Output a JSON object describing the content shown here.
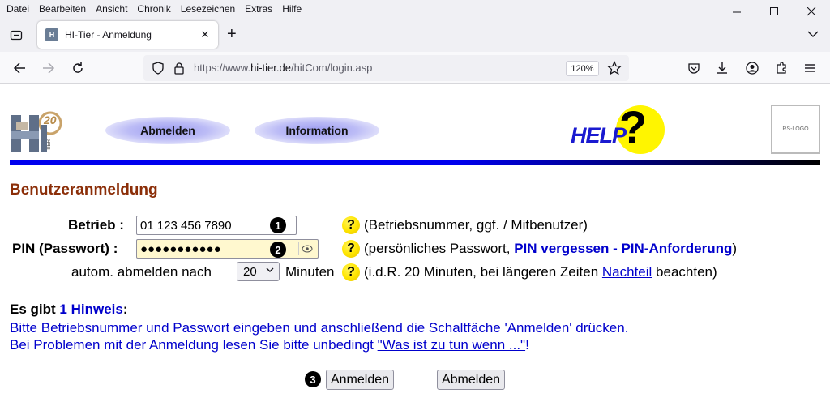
{
  "menubar": {
    "items": [
      "Datei",
      "Bearbeiten",
      "Ansicht",
      "Chronik",
      "Lesezeichen",
      "Extras",
      "Hilfe"
    ]
  },
  "tab": {
    "title": "HI-Tier - Anmeldung",
    "favicon_text": "H"
  },
  "navbar": {
    "url_prefix": "https://www.",
    "url_domain": "hi-tier.de",
    "url_path": "/hitCom/login.asp",
    "zoom": "120%"
  },
  "header": {
    "logo_text": "HI",
    "logo_number": "20",
    "logo_side": "TIER",
    "nav_abmelden": "Abmelden",
    "nav_information": "Information",
    "help_text": "HELP",
    "help_mark": "?",
    "rs_logo": "RS-LOGO"
  },
  "form": {
    "heading": "Benutzeranmeldung",
    "betrieb_label": "Betrieb :",
    "betrieb_value": "01 123 456 7890",
    "betrieb_badge": "1",
    "betrieb_help": "(Betriebsnummer, ggf. / Mitbenutzer)",
    "pin_label": "PIN (Passwort) :",
    "pin_value": "●●●●●●●●●●●",
    "pin_badge": "2",
    "pin_help_pre": "(persönliches Passwort, ",
    "pin_help_link": "PIN vergessen - PIN-Anforderung",
    "pin_help_post": ")",
    "logout_label": "autom. abmelden nach",
    "logout_value": "20",
    "logout_unit": "Minuten",
    "logout_help_pre": "(i.d.R. 20 Minuten, bei längeren Zeiten ",
    "logout_help_link": "Nachteil",
    "logout_help_post": " beachten)",
    "question_mark": "?"
  },
  "hints": {
    "title_pre": "Es gibt ",
    "title_count": "1 Hinweis",
    "title_post": ":",
    "line1": "Bitte Betriebsnummer und Passwort eingeben und anschließend die Schaltfäche 'Anmelden' drücken.",
    "line2_pre": "Bei Problemen mit der Anmeldung lesen Sie bitte unbedingt ",
    "line2_link": "\"Was ist zu tun wenn ...\"",
    "line2_post": "!"
  },
  "buttons": {
    "badge": "3",
    "anmelden": "Anmelden",
    "abmelden": "Abmelden"
  }
}
